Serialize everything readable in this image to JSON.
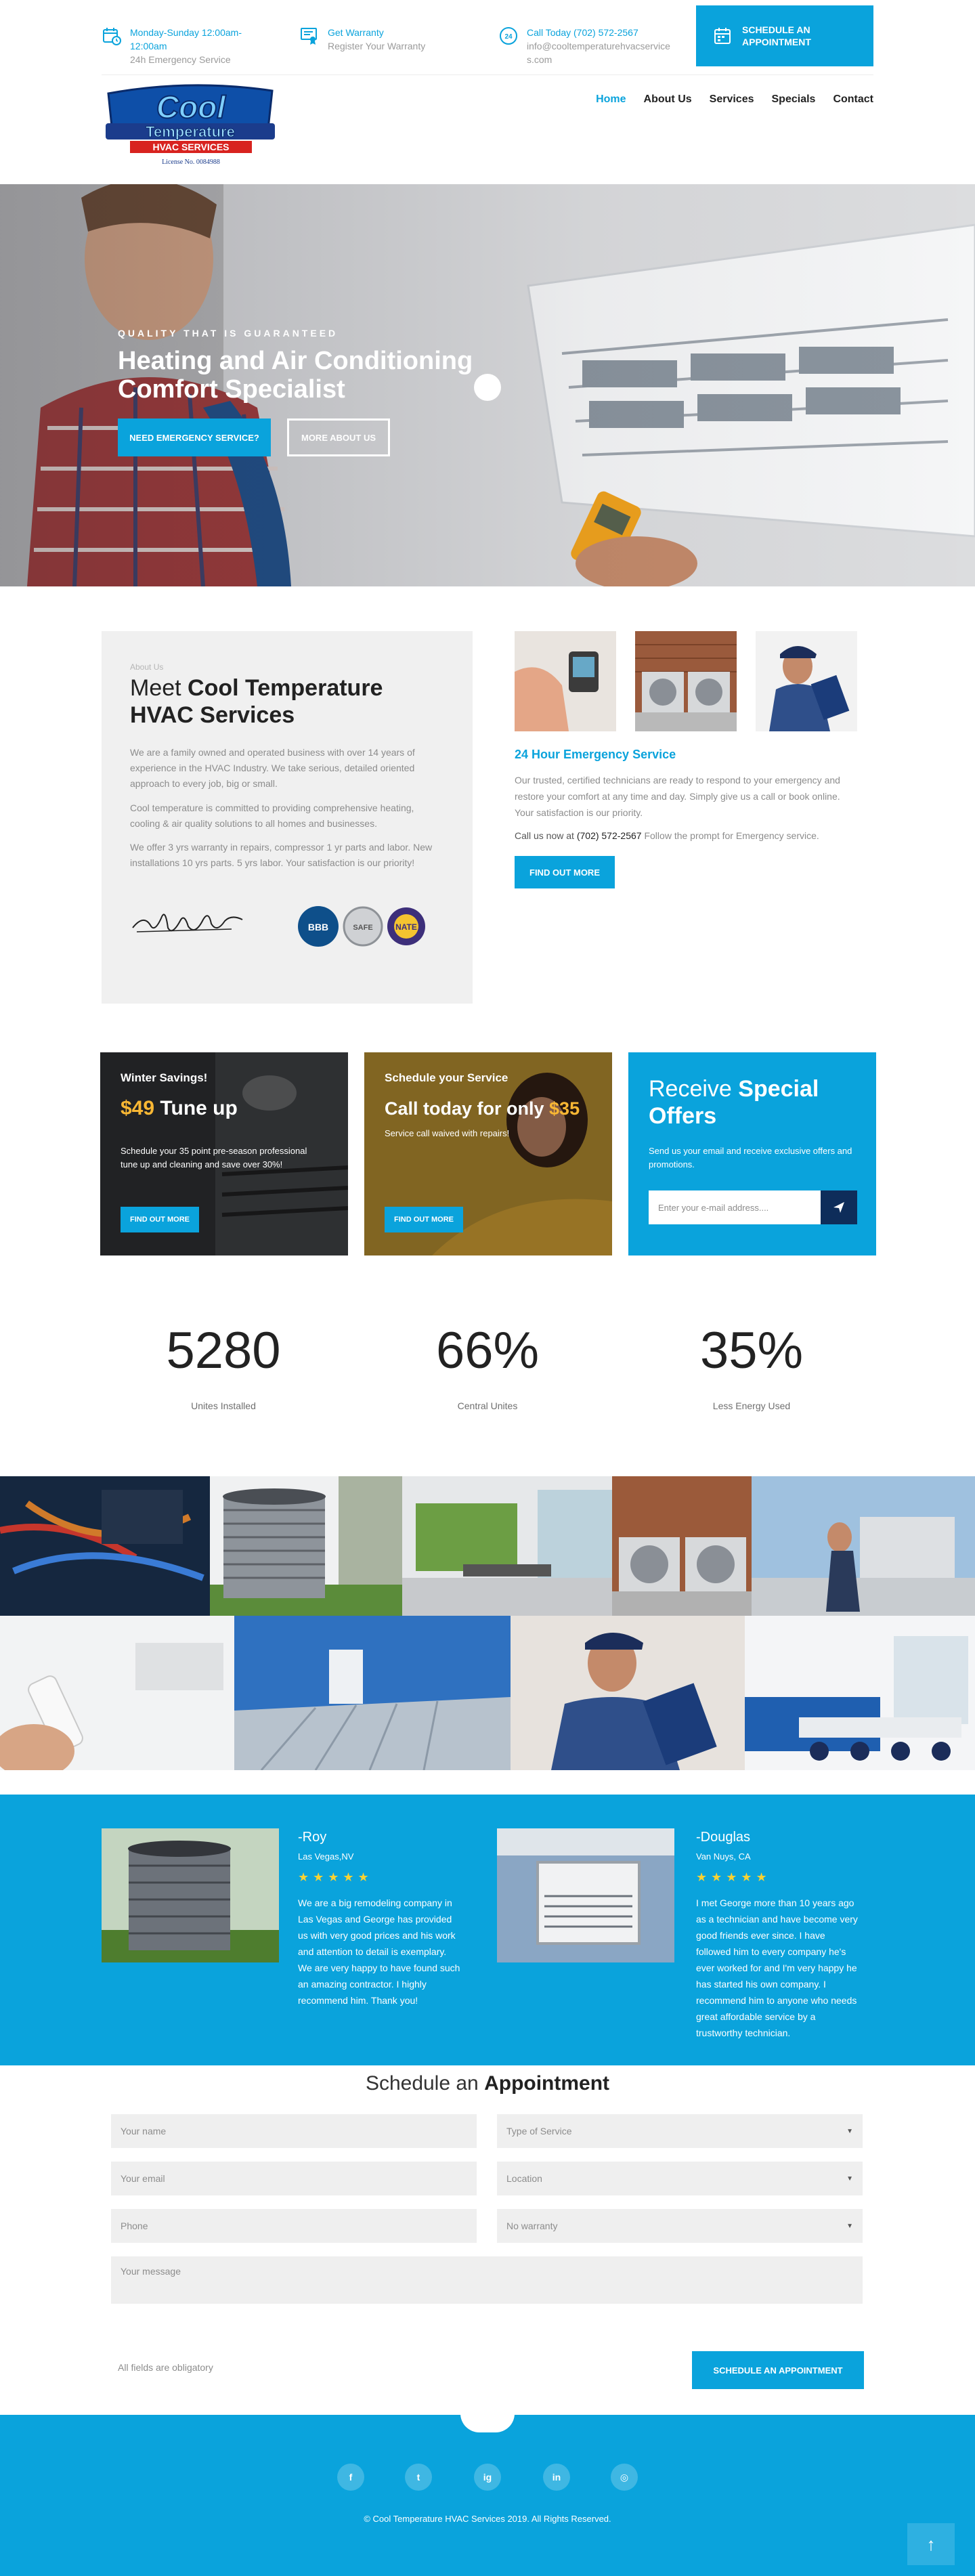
{
  "topbar": {
    "hours": {
      "line1": "Monday-Sunday 12:00am-",
      "line2": "12:00am",
      "line3": "24h Emergency Service"
    },
    "warranty": {
      "line1": "Get Warranty",
      "line2": "Register Your Warranty"
    },
    "call": {
      "line1": "Call Today (702) 572-2567",
      "line2": "info@cooltemperaturehvacservice",
      "line3": "s.com"
    },
    "schedule_button": {
      "line1": "SCHEDULE AN",
      "line2": "APPOINTMENT"
    }
  },
  "logo": {
    "line1": "Cool",
    "line2": "Temperature",
    "line3": "HVAC SERVICES",
    "license": "License No. 0084988"
  },
  "nav": {
    "items": [
      "Home",
      "About Us",
      "Services",
      "Specials",
      "Contact"
    ],
    "active": "Home"
  },
  "hero": {
    "kicker": "QUALITY THAT IS GUARANTEED",
    "title": "Heating and Air Conditioning Comfort Specialist",
    "button_primary": "NEED EMERGENCY SERVICE?",
    "button_secondary": "MORE ABOUT US"
  },
  "about": {
    "kicker": "About Us",
    "title_light": "Meet ",
    "title_bold": "Cool Temperature HVAC Services",
    "p1": "We are a family owned and operated business with over 14 years of experience in the HVAC Industry. We take serious, detailed oriented approach to every job, big or small.",
    "p2": "Cool temperature is committed to providing comprehensive heating, cooling & air quality solutions to all homes and businesses.",
    "p3": "We offer 3 yrs warranty in repairs, compressor 1 yr parts and labor. New installations 10 yrs parts. 5 yrs labor. Your satisfaction is our priority!",
    "badges": [
      "BBB",
      "SAFE",
      "NATE"
    ]
  },
  "emergency": {
    "title": "24 Hour Emergency Service",
    "p1": "Our trusted, certified technicians are ready to respond to your emergency and restore your comfort at any time and day. Simply give us a call or book online. Your satisfaction is our priority.",
    "call_label": "Call us now at ",
    "call_number": "(702) 572-2567",
    "call_suffix": " Follow the prompt for Emergency service.",
    "button": "FIND OUT MORE"
  },
  "promos": [
    {
      "kicker": "Winter Savings!",
      "price": "$49",
      "headline": " Tune up",
      "text": "Schedule your 35 point pre-season professional tune up and cleaning and save over 30%!",
      "button": "FIND OUT MORE"
    },
    {
      "kicker": "Schedule your Service",
      "headline": "Call today for only ",
      "price": "$35",
      "text": "Service call waived with repairs!",
      "button": "FIND OUT MORE"
    }
  ],
  "special": {
    "title_light": "Receive ",
    "title_bold": "Special Offers",
    "text": "Send us your email and receive exclusive offers and promotions.",
    "placeholder": "Enter your e-mail address...."
  },
  "stats": [
    {
      "number": "5280",
      "label": "Unites Installed"
    },
    {
      "number": "66%",
      "label": "Central Unites"
    },
    {
      "number": "35%",
      "label": "Less Energy Used"
    }
  ],
  "testimonials": [
    {
      "name": "-Roy",
      "location": "Las Vegas,NV",
      "stars": "★★★★★",
      "text": "We are a big remodeling company in Las Vegas and George has provided us with very good prices and his work and attention to detail is exemplary. We are very happy to have found such an amazing contractor. I highly recommend him. Thank you!"
    },
    {
      "name": "-Douglas",
      "location": "Van Nuys, CA",
      "stars": "★★★★★",
      "text": "I met George more than 10 years ago as a technician and have become very good friends ever since. I have followed him to every company he's ever worked for and I'm very happy he has started his own company. I recommend him to anyone who needs great affordable service by a trustworthy technician."
    }
  ],
  "appointment": {
    "title_light": "Schedule an ",
    "title_bold": "Appointment",
    "name": "Your name",
    "email": "Your email",
    "phone": "Phone",
    "service": "Type of Service",
    "location": "Location",
    "warranty": "No warranty",
    "message": "Your message",
    "note": "All fields are obligatory",
    "submit": "SCHEDULE AN APPOINTMENT"
  },
  "footer": {
    "social": [
      "f",
      "t",
      "ig",
      "in",
      "◎"
    ],
    "copyright": "© Cool Temperature HVAC Services 2019. All Rights Reserved."
  },
  "colors": {
    "brand_blue": "#0aa3dc",
    "navy": "#0e2d5a",
    "accent_yellow": "#f8b734"
  }
}
